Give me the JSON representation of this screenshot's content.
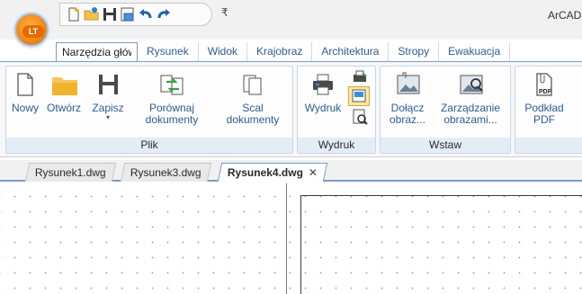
{
  "titlebar": {
    "app_title": "ArCAD",
    "app_button_label": "LT",
    "quick_access": [
      "new-icon",
      "open-icon",
      "save-icon",
      "print-preview-icon",
      "undo-icon",
      "redo-icon"
    ],
    "more_glyph": "₹"
  },
  "tabs": [
    {
      "label": "Narzędzia główne",
      "active": true
    },
    {
      "label": "Rysunek"
    },
    {
      "label": "Widok"
    },
    {
      "label": "Krajobraz"
    },
    {
      "label": "Architektura"
    },
    {
      "label": "Stropy"
    },
    {
      "label": "Ewakuacja"
    }
  ],
  "ribbon": {
    "groups": [
      {
        "label": "Plik",
        "buttons": [
          {
            "label": "Nowy",
            "icon": "new-document-icon"
          },
          {
            "label": "Otwórz",
            "icon": "folder-open-icon"
          },
          {
            "label": "Zapisz",
            "icon": "floppy-save-icon",
            "dropdown": "▾"
          },
          {
            "label": "Porównaj\ndokumenty",
            "icon": "compare-documents-icon"
          },
          {
            "label": "Scal\ndokumenty",
            "icon": "merge-documents-icon"
          }
        ]
      },
      {
        "label": "Wydruk",
        "buttons": [
          {
            "label": "Wydruk",
            "icon": "printer-icon"
          }
        ]
      },
      {
        "label": "Wstaw",
        "buttons": [
          {
            "label": "Dołącz\nobraz...",
            "icon": "attach-image-icon"
          },
          {
            "label": "Zarządzanie\nobrazami...",
            "icon": "manage-images-icon",
            "dropdown": "▾"
          }
        ]
      },
      {
        "label": "",
        "buttons": [
          {
            "label": "Podkład\nPDF",
            "icon": "pdf-underlay-icon",
            "icon_text": "PDF"
          }
        ]
      }
    ]
  },
  "document_tabs": [
    {
      "label": "Rysunek1.dwg"
    },
    {
      "label": "Rysunek3.dwg"
    },
    {
      "label": "Rysunek4.dwg",
      "active": true,
      "close": "✕"
    }
  ],
  "colors": {
    "accent": "#2a5d9a",
    "ribbon_group_label_bg": "#e3ecf7",
    "app_button": "#f28a1c"
  }
}
